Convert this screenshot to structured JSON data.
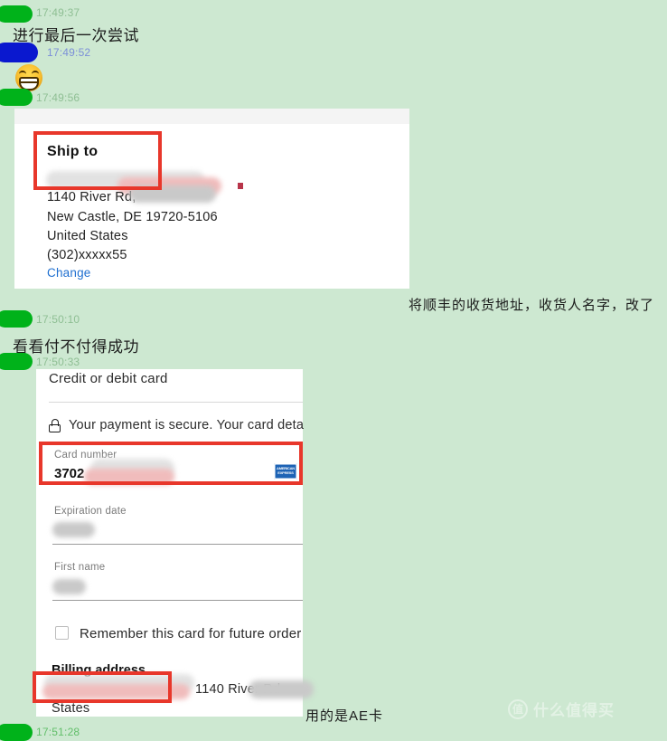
{
  "chat": {
    "messages": [
      {
        "time": "17:49:37",
        "text": "进行最后一次尝试"
      },
      {
        "time": "17:49:52",
        "text": ""
      },
      {
        "time": "17:49:56",
        "text": ""
      },
      {
        "time": "17:50:10",
        "text": "看看付不付得成功"
      },
      {
        "time": "17:50:33",
        "text": ""
      },
      {
        "time": "17:51:28",
        "text": ""
      }
    ]
  },
  "shipping_card": {
    "title": "Ship to",
    "lines": [
      "1140 River Rd,",
      "New Castle, DE 19720-5106",
      "United States",
      "(302)xxxxx55"
    ],
    "change_link": "Change"
  },
  "payment_card": {
    "heading": "Credit or debit card",
    "secure_note": "Your payment is secure. Your card deta",
    "card_number_label": "Card number",
    "card_number_value": "3702",
    "card_brand": "AMERICAN EXPRESS",
    "expiration_label": "Expiration date",
    "first_name_label": "First name",
    "remember_label": "Remember this card for future order",
    "billing_title": "Billing address",
    "billing_line": "1140 River Rd",
    "billing_line2": "States"
  },
  "annotations": {
    "shipping_note": "将顺丰的收货地址，收货人名字，改了",
    "card_note": "用的是AE卡"
  },
  "watermark": {
    "badge": "值",
    "text": "什么值得买"
  },
  "colors": {
    "background": "#cde8d1",
    "redaction_green": "#00b21a",
    "redaction_blue": "#0a18cf",
    "highlight_red": "#e8372b",
    "link_blue": "#1f6fd0",
    "amex_blue": "#1d63b5"
  }
}
